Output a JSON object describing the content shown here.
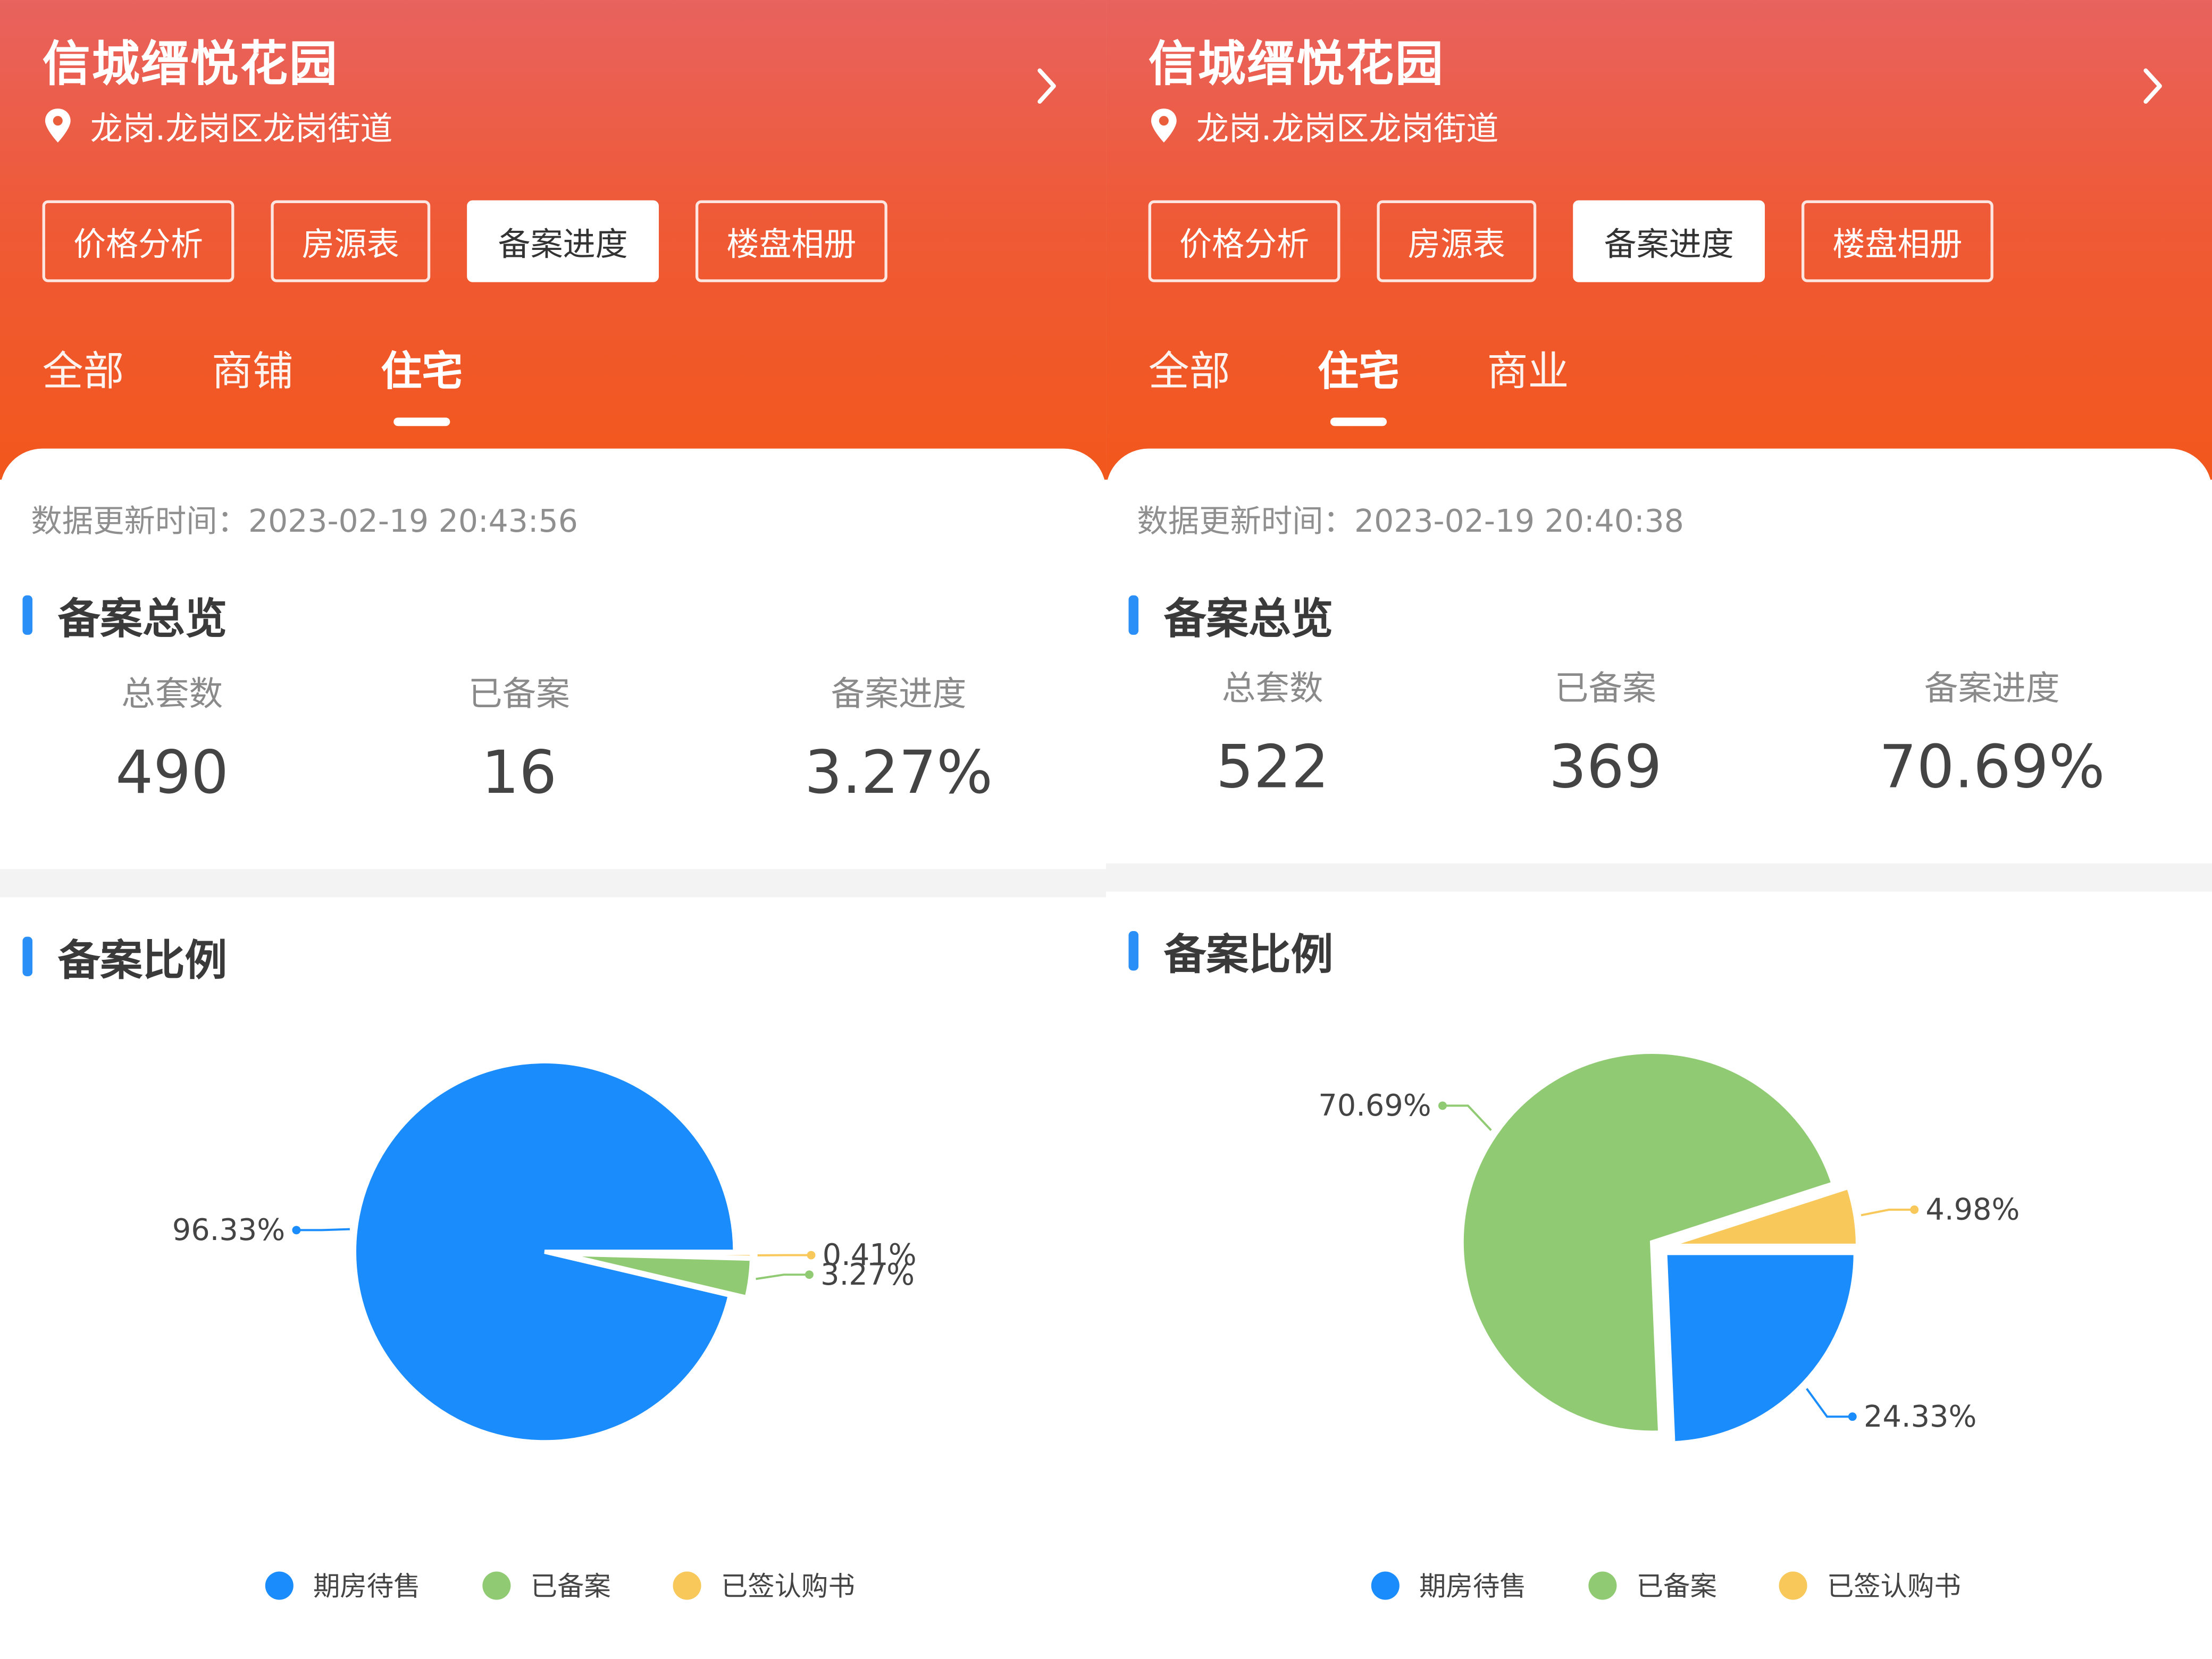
{
  "colors": {
    "accent": "#2a8ff7",
    "blue": "#1a8cfb",
    "green": "#90cb74",
    "yellow": "#f8c95a"
  },
  "legend": [
    {
      "label": "期房待售",
      "color": "#1a8cfb"
    },
    {
      "label": "已备案",
      "color": "#90cb74"
    },
    {
      "label": "已签认购书",
      "color": "#f8c95a"
    }
  ],
  "panels": [
    {
      "title": "信城缙悦花园",
      "location": "龙岗.龙岗区龙岗街道",
      "buttons": [
        "价格分析",
        "房源表",
        "备案进度",
        "楼盘相册"
      ],
      "active_button": "备案进度",
      "tabs": [
        "全部",
        "商铺",
        "住宅"
      ],
      "active_tab": "住宅",
      "update_time": "数据更新时间：2023-02-19 20:43:56",
      "overview_title": "备案总览",
      "stats": [
        {
          "label": "总套数",
          "value": "490"
        },
        {
          "label": "已备案",
          "value": "16"
        },
        {
          "label": "备案进度",
          "value": "3.27%"
        }
      ],
      "ratio_title": "备案比例",
      "chart_data": {
        "type": "pie",
        "slices": [
          {
            "name": "期房待售",
            "value": 96.33,
            "label": "96.33%",
            "color": "#1a8cfb"
          },
          {
            "name": "已备案",
            "value": 3.27,
            "label": "3.27%",
            "color": "#90cb74"
          },
          {
            "name": "已签认购书",
            "value": 0.41,
            "label": "0.41%",
            "color": "#f8c95a"
          }
        ]
      }
    },
    {
      "title": "信城缙悦花园",
      "location": "龙岗.龙岗区龙岗街道",
      "buttons": [
        "价格分析",
        "房源表",
        "备案进度",
        "楼盘相册"
      ],
      "active_button": "备案进度",
      "tabs": [
        "全部",
        "住宅",
        "商业"
      ],
      "active_tab": "住宅",
      "update_time": "数据更新时间：2023-02-19 20:40:38",
      "overview_title": "备案总览",
      "stats": [
        {
          "label": "总套数",
          "value": "522"
        },
        {
          "label": "已备案",
          "value": "369"
        },
        {
          "label": "备案进度",
          "value": "70.69%"
        }
      ],
      "ratio_title": "备案比例",
      "chart_data": {
        "type": "pie",
        "slices": [
          {
            "name": "期房待售",
            "value": 24.33,
            "label": "24.33%",
            "color": "#1a8cfb"
          },
          {
            "name": "已备案",
            "value": 70.69,
            "label": "70.69%",
            "color": "#90cb74"
          },
          {
            "name": "已签认购书",
            "value": 4.98,
            "label": "4.98%",
            "color": "#f8c95a"
          }
        ]
      }
    }
  ]
}
